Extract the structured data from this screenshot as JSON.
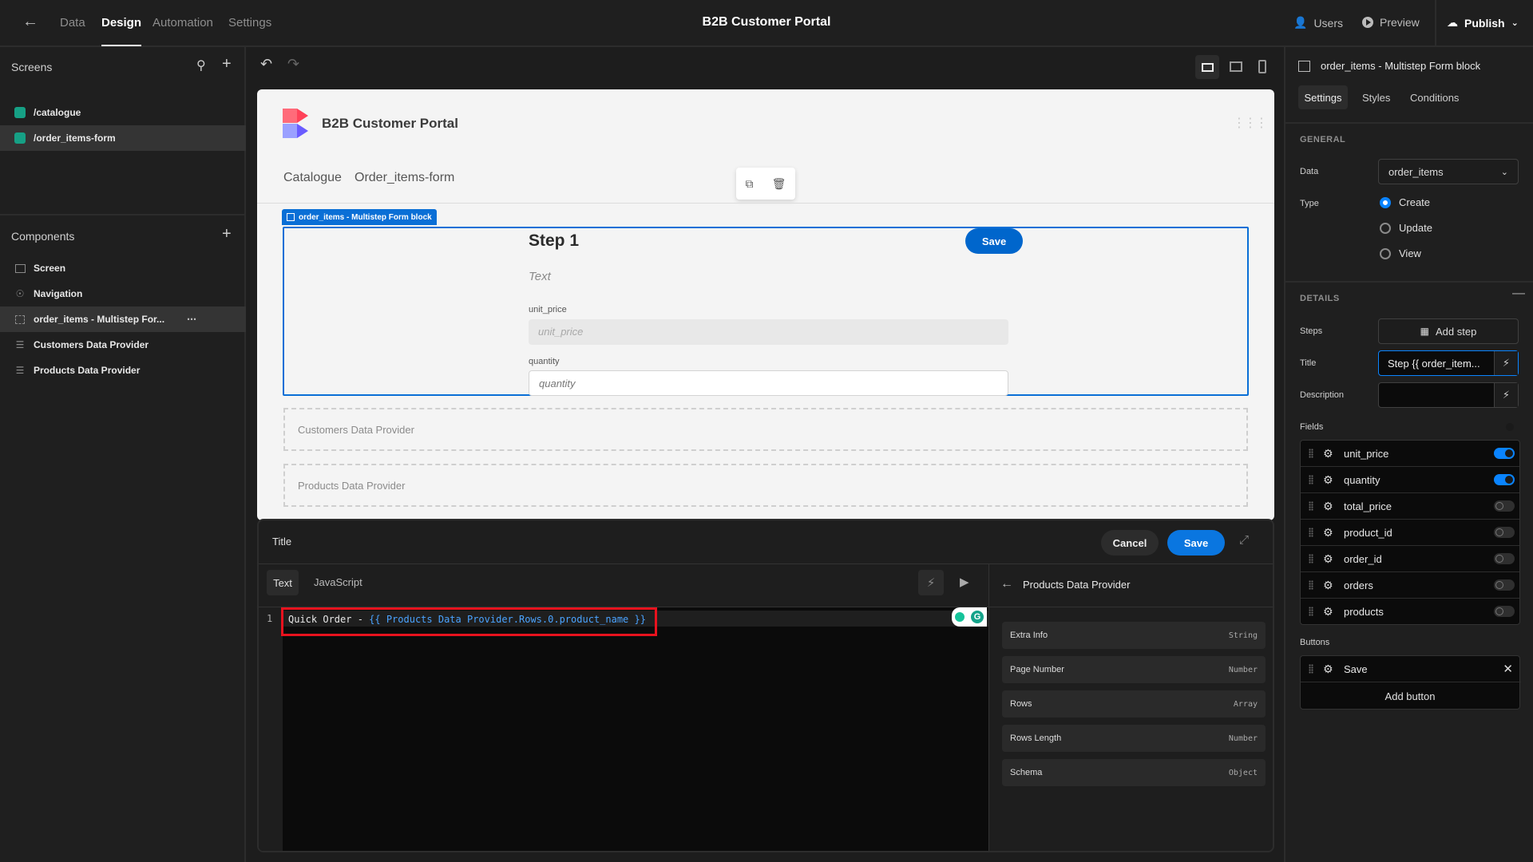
{
  "topbar": {
    "tabs": [
      {
        "label": "Data",
        "active": false
      },
      {
        "label": "Design",
        "active": true
      },
      {
        "label": "Automation",
        "active": false
      },
      {
        "label": "Settings",
        "active": false
      }
    ],
    "title": "B2B Customer Portal",
    "users_label": "Users",
    "preview_label": "Preview",
    "publish_label": "Publish"
  },
  "screens": {
    "title": "Screens",
    "items": [
      {
        "label": "/catalogue",
        "selected": false
      },
      {
        "label": "/order_items-form",
        "selected": true
      }
    ]
  },
  "components": {
    "title": "Components",
    "items": [
      {
        "label": "Screen",
        "icon": "screen-icon"
      },
      {
        "label": "Navigation",
        "icon": "eye-icon"
      },
      {
        "label": "order_items - Multistep For...",
        "icon": "form-block-icon",
        "selected": true
      },
      {
        "label": "Customers Data Provider",
        "icon": "database-icon"
      },
      {
        "label": "Products Data Provider",
        "icon": "database-icon"
      }
    ]
  },
  "canvas": {
    "app_title": "B2B Customer Portal",
    "nav_links": [
      "Catalogue",
      "Order_items-form"
    ],
    "block_tag": "order_items - Multistep Form block",
    "step_title": "Step 1",
    "step_description": "Text",
    "save_label": "Save",
    "fields": [
      {
        "label": "unit_price",
        "placeholder": "unit_price",
        "disabled": true
      },
      {
        "label": "quantity",
        "placeholder": "quantity",
        "disabled": false
      }
    ],
    "placeholders": [
      "Customers Data Provider",
      "Products Data Provider"
    ]
  },
  "binding": {
    "title": "Title",
    "cancel_label": "Cancel",
    "save_label": "Save",
    "mode_tabs": [
      "Text",
      "JavaScript"
    ],
    "line_number": "1",
    "code_plain": "Quick Order - ",
    "code_binding": "{{ Products Data Provider.Rows.0.product_name }}",
    "provider_title": "Products Data Provider",
    "properties": [
      {
        "name": "Extra Info",
        "type": "String"
      },
      {
        "name": "Page Number",
        "type": "Number"
      },
      {
        "name": "Rows",
        "type": "Array"
      },
      {
        "name": "Rows Length",
        "type": "Number"
      },
      {
        "name": "Schema",
        "type": "Object"
      }
    ]
  },
  "settings": {
    "header": "order_items - Multistep Form block",
    "tabs": [
      "Settings",
      "Styles",
      "Conditions"
    ],
    "general_heading": "GENERAL",
    "data_label": "Data",
    "data_value": "order_items",
    "type_label": "Type",
    "type_options": [
      {
        "label": "Create",
        "selected": true
      },
      {
        "label": "Update",
        "selected": false
      },
      {
        "label": "View",
        "selected": false
      }
    ],
    "details_heading": "DETAILS",
    "steps_label": "Steps",
    "add_step_label": "Add step",
    "title_label": "Title",
    "title_value": "Step {{ order_item...",
    "description_label": "Description",
    "description_value": "",
    "fields_label": "Fields",
    "fields_enabled": true,
    "fields": [
      {
        "name": "unit_price",
        "enabled": true
      },
      {
        "name": "quantity",
        "enabled": true
      },
      {
        "name": "total_price",
        "enabled": false
      },
      {
        "name": "product_id",
        "enabled": false
      },
      {
        "name": "order_id",
        "enabled": false
      },
      {
        "name": "orders",
        "enabled": false
      },
      {
        "name": "products",
        "enabled": false
      }
    ],
    "buttons_label": "Buttons",
    "buttons": [
      {
        "name": "Save"
      }
    ],
    "add_button_label": "Add button"
  },
  "colors": {
    "accent": "#0a84ff",
    "button_blue": "#0066cc",
    "screen_green": "#16a085",
    "highlight_red": "#e8121e"
  }
}
